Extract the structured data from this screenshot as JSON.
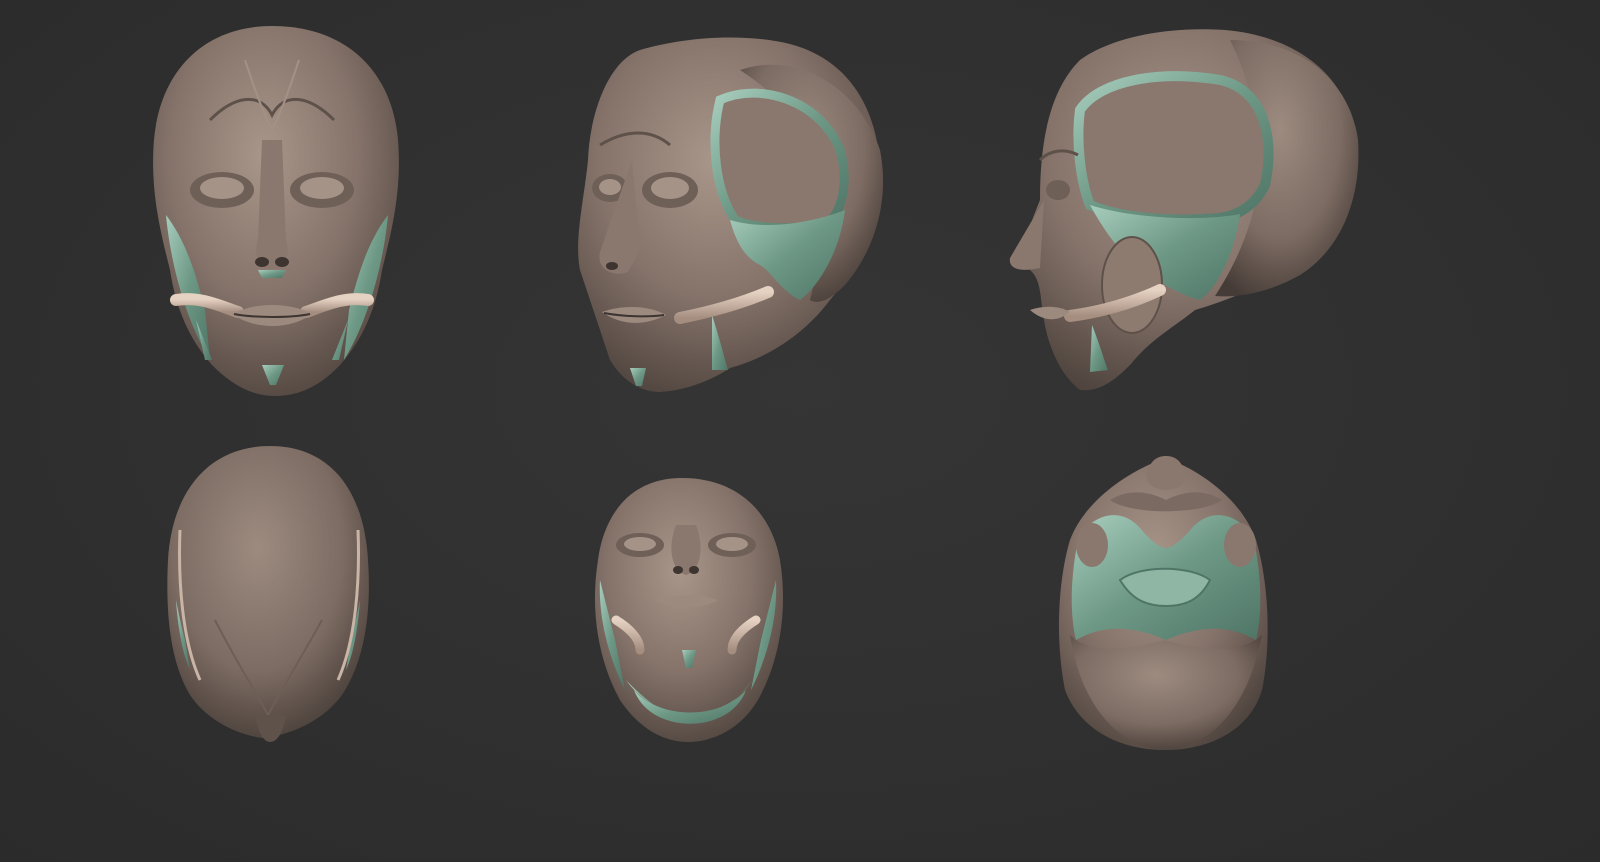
{
  "scene": {
    "background_color": "#2f2f2f",
    "skin_color": "#8e7b70",
    "skin_highlight": "#b9a79b",
    "skin_shadow": "#4e433d",
    "tendon_color": "#d6bfae",
    "fascia_color": "#6e9c8a",
    "fascia_highlight": "#a9cfc0"
  },
  "views": [
    {
      "id": "front",
      "icon": "head-front-view-icon"
    },
    {
      "id": "three-quarter",
      "icon": "head-three-quarter-view-icon"
    },
    {
      "id": "side",
      "icon": "head-side-view-icon"
    },
    {
      "id": "top",
      "icon": "head-top-view-icon"
    },
    {
      "id": "low-front",
      "icon": "head-low-front-view-icon"
    },
    {
      "id": "bottom",
      "icon": "head-bottom-view-icon"
    }
  ]
}
